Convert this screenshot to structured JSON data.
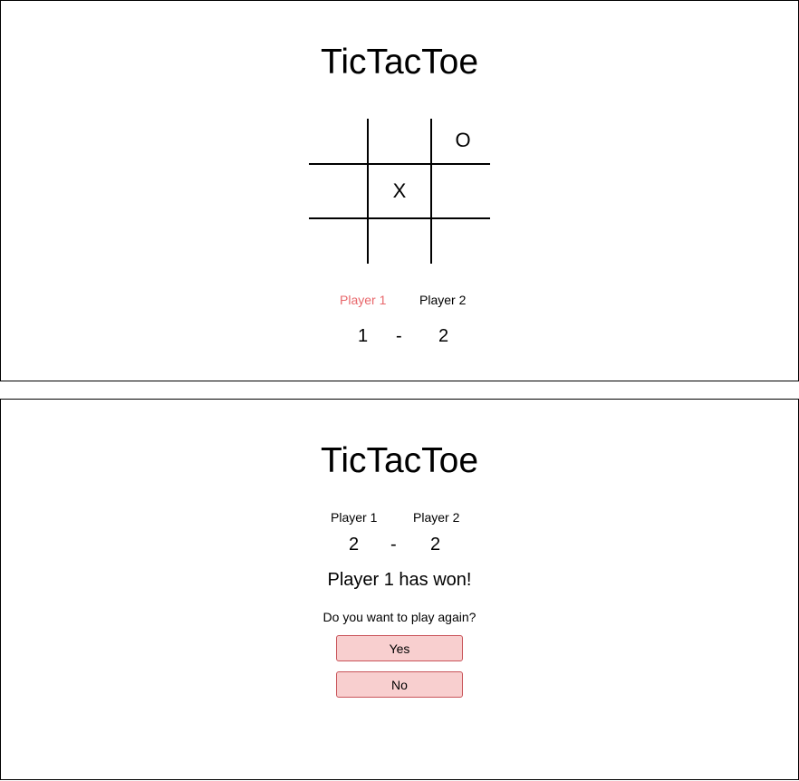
{
  "colors": {
    "active_player": "#e8676b",
    "button_bg": "#f8cfcf",
    "button_border": "#c9545a"
  },
  "game_screen": {
    "title": "TicTacToe",
    "board": [
      "",
      "",
      "O",
      "",
      "X",
      "",
      "",
      "",
      ""
    ],
    "players": {
      "p1": "Player 1",
      "p2": "Player 2",
      "active": "p1"
    },
    "score": {
      "p1": "1",
      "separator": "-",
      "p2": "2"
    }
  },
  "result_screen": {
    "title": "TicTacToe",
    "players": {
      "p1": "Player 1",
      "p2": "Player 2"
    },
    "score": {
      "p1": "2",
      "separator": "-",
      "p2": "2"
    },
    "winner_message": "Player 1 has won!",
    "prompt": "Do you want to play again?",
    "yes_label": "Yes",
    "no_label": "No"
  }
}
